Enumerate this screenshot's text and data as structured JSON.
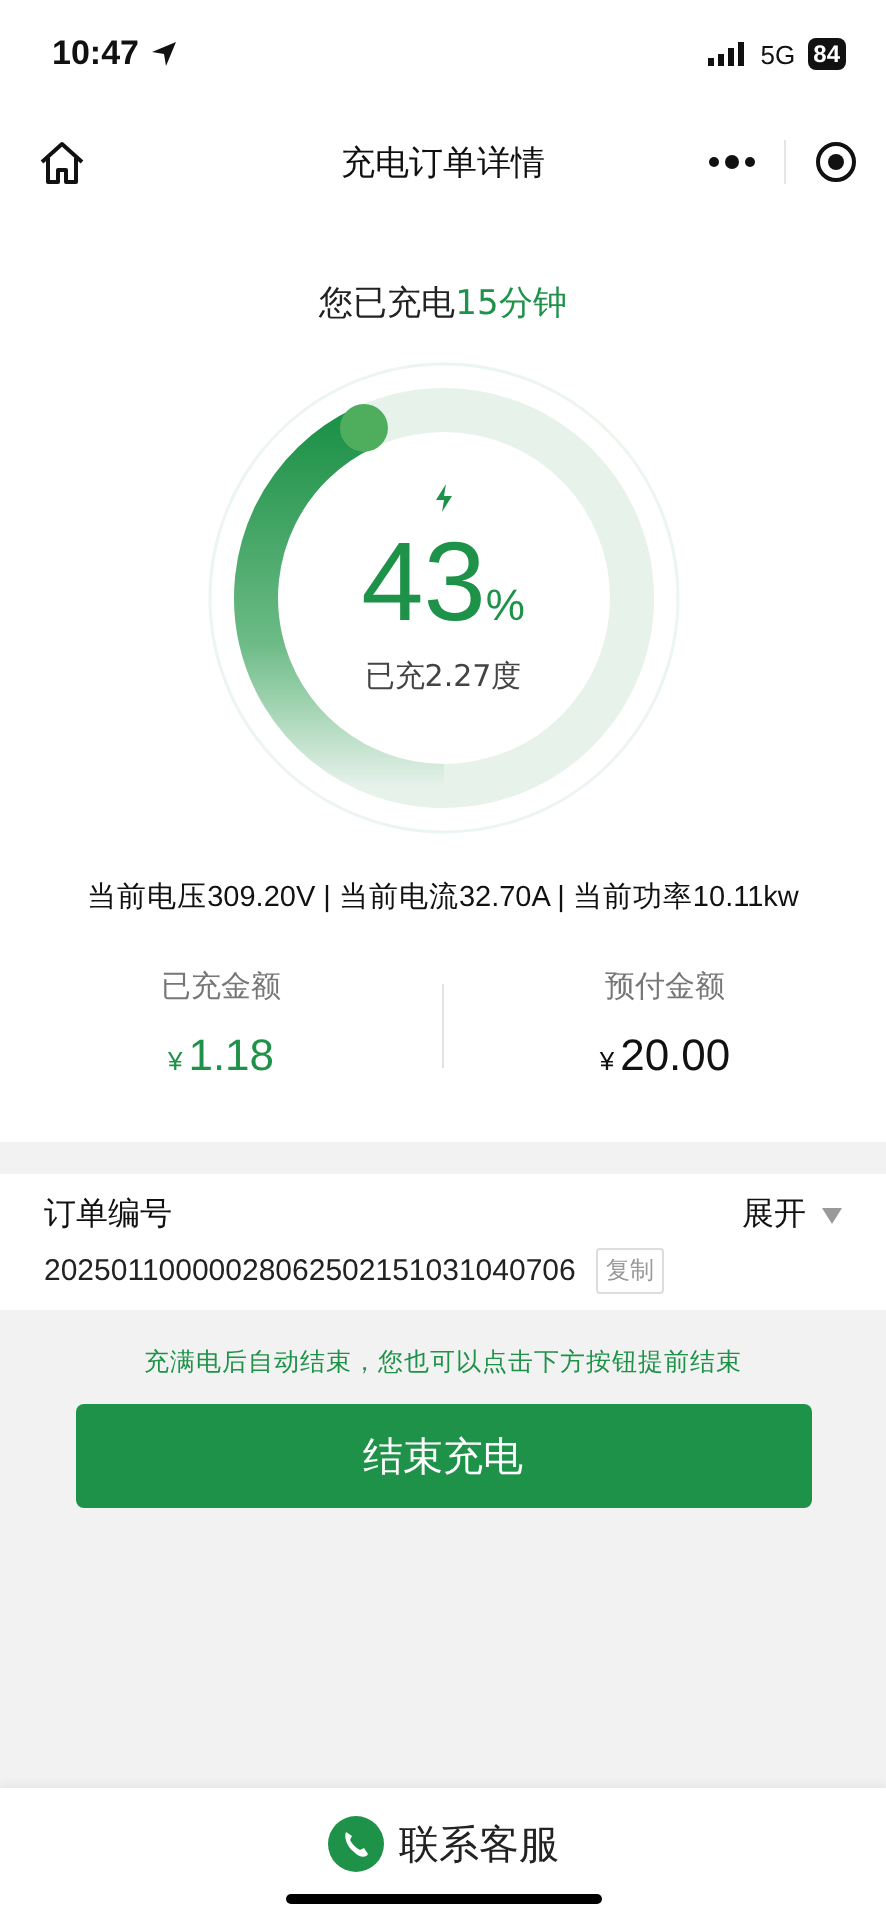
{
  "status_bar": {
    "time": "10:47",
    "network": "5G",
    "battery": "84"
  },
  "nav": {
    "title": "充电订单详情"
  },
  "duration": {
    "prefix": "您已充电",
    "value": "15分钟"
  },
  "gauge": {
    "percent": "43",
    "unit": "%",
    "energy": "已充2.27度"
  },
  "metrics": "当前电压309.20V | 当前电流32.70A | 当前功率10.11kw",
  "amounts": [
    {
      "label": "已充金额",
      "currency": "¥",
      "value": "1.18",
      "highlight": true
    },
    {
      "label": "预付金额",
      "currency": "¥",
      "value": "20.00",
      "highlight": false
    }
  ],
  "order": {
    "label": "订单编号",
    "toggle": "展开",
    "number": "20250110000028062502151031040706",
    "copy": "复制"
  },
  "hint": "充满电后自动结束，您也可以点击下方按钮提前结束",
  "stop_button": "结束充电",
  "contact": "联系客服"
}
